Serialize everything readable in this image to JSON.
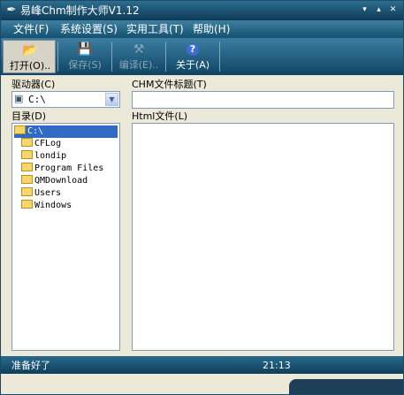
{
  "window": {
    "title": "易峰Chm制作大师V1.12",
    "app_icon": "feather-icon",
    "controls": [
      "▾",
      "▴",
      "✕"
    ]
  },
  "menu": [
    {
      "label": "文件(F)"
    },
    {
      "label": "系统设置(S)"
    },
    {
      "label": "实用工具(T)"
    },
    {
      "label": "帮助(H)"
    }
  ],
  "toolbar": {
    "open": {
      "label": "打开(O)..",
      "icon": "open-folder-icon",
      "glyph": "📂"
    },
    "save": {
      "label": "保存(S)",
      "icon": "floppy-disk-icon",
      "glyph": "💾"
    },
    "compile": {
      "label": "编译(E)..",
      "icon": "compile-icon",
      "glyph": "⚒"
    },
    "about": {
      "label": "关于(A)",
      "icon": "help-icon",
      "glyph": "?"
    }
  },
  "drive": {
    "label": "驱动器(C)",
    "value": "C:\\",
    "icon": "drive-icon"
  },
  "directory": {
    "label": "目录(D)",
    "root": "C:\\",
    "folders": [
      "CFLog",
      "londip",
      "Program Files",
      "QMDownload",
      "Users",
      "Windows"
    ]
  },
  "chm_title": {
    "label": "CHM文件标题(T)",
    "value": ""
  },
  "html_file": {
    "label": "Html文件(L)"
  },
  "status": {
    "text": "准备好了",
    "time": "21:13"
  },
  "colors": {
    "title_bar": "#0e3a55",
    "accent": "#316ac5",
    "surface": "#ece9d8"
  }
}
